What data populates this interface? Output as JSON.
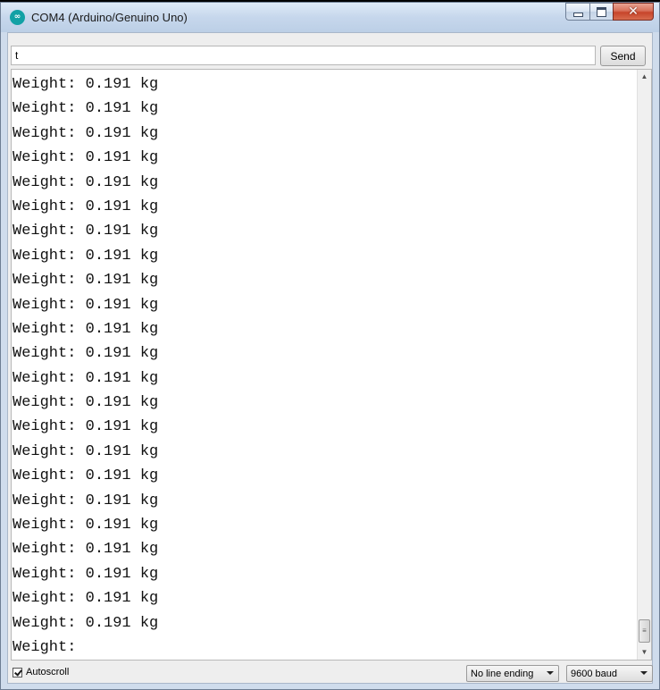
{
  "window": {
    "title": "COM4 (Arduino/Genuino Uno)",
    "icon": "arduino-icon",
    "controls": {
      "minimize": "minimize-icon",
      "maximize": "maximize-icon",
      "close": "close-icon"
    }
  },
  "send_bar": {
    "input_value": "t",
    "send_label": "Send"
  },
  "output": {
    "lines": [
      "Weight: 0.191 kg",
      "Weight: 0.191 kg",
      "Weight: 0.191 kg",
      "Weight: 0.191 kg",
      "Weight: 0.191 kg",
      "Weight: 0.191 kg",
      "Weight: 0.191 kg",
      "Weight: 0.191 kg",
      "Weight: 0.191 kg",
      "Weight: 0.191 kg",
      "Weight: 0.191 kg",
      "Weight: 0.191 kg",
      "Weight: 0.191 kg",
      "Weight: 0.191 kg",
      "Weight: 0.191 kg",
      "Weight: 0.191 kg",
      "Weight: 0.191 kg",
      "Weight: 0.191 kg",
      "Weight: 0.191 kg",
      "Weight: 0.191 kg",
      "Weight: 0.191 kg",
      "Weight: 0.191 kg",
      "Weight: 0.191 kg",
      "Weight:"
    ]
  },
  "footer": {
    "autoscroll_label": "Autoscroll",
    "autoscroll_checked": true,
    "line_ending": "No line ending",
    "baud_rate": "9600 baud"
  },
  "colors": {
    "app_icon": "#12a1a5",
    "close_button": "#c7442a"
  }
}
